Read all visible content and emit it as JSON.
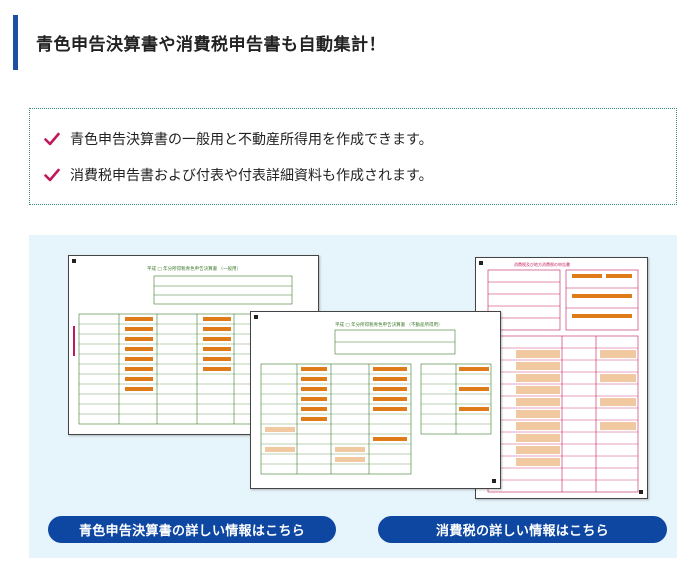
{
  "heading": {
    "title": "青色申告決算書や消費税申告書も自動集計！"
  },
  "features": {
    "items": [
      "青色申告決算書の一般用と不動産所得用を作成できます。",
      "消費税申告書および付表や付表詳細資料も作成されます。"
    ],
    "check_color": "#c2185b"
  },
  "forms": {
    "doc1": {
      "title": "平成 □ 年分所得税青色申告決算書 （一般用）"
    },
    "doc2": {
      "title": "平成 □ 年分所得税青色申告決算書 （不動産所得用）"
    },
    "doc3": {
      "title": "消費税及び地方消費税の申告書"
    }
  },
  "buttons": {
    "blue_return_label": "青色申告決算書の詳しい情報はこちら",
    "consumption_tax_label": "消費税の詳しい情報はこちら"
  },
  "colors": {
    "accent_bar": "#1f4fa3",
    "button_bg": "#0d47a1",
    "panel_bg": "#e6f4fb",
    "form_green": "#3d7a2a",
    "form_orange": "#e07b1a",
    "form_pink": "#c2185b"
  }
}
